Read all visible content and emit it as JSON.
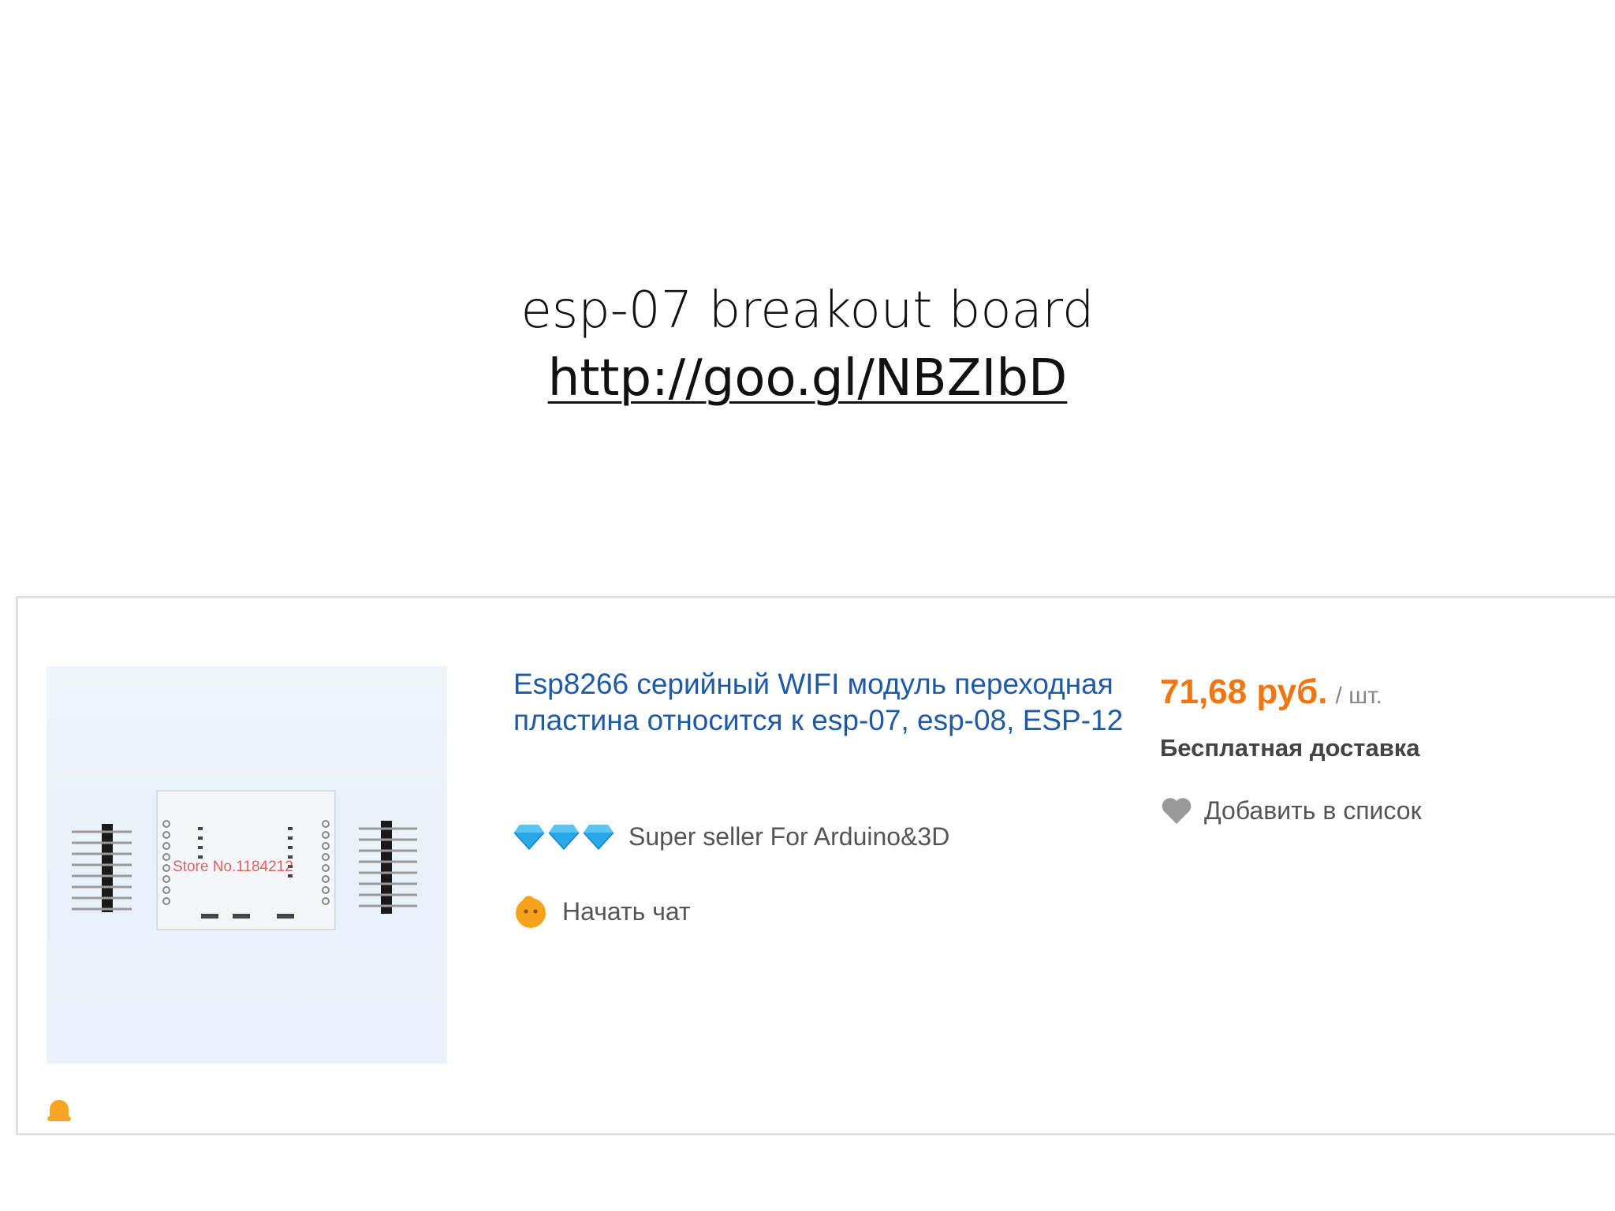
{
  "slide": {
    "title": "esp-07 breakout board",
    "link": "http://goo.gl/NBZIbD"
  },
  "listing": {
    "image_caption": "Store No.1184212",
    "product_title": "Esp8266 серийный WIFI модуль переходная пластина относится к esp-07, esp-08, ESP-12",
    "seller": {
      "rating_icon": "diamond-icon",
      "rating_count": 3,
      "name": "Super seller For Arduino&3D"
    },
    "chat_label": "Начать чат",
    "price": {
      "value": "71,68 руб.",
      "unit": "/ шт."
    },
    "shipping": "Бесплатная доставка",
    "wishlist_label": "Добавить в список"
  },
  "colors": {
    "title_link": "#1f5aa6",
    "price": "#f07613",
    "diamond": "#29a7e8",
    "chat_icon": "#f7a21b",
    "heart": "#9a9a9a",
    "bell": "#f5a623"
  }
}
